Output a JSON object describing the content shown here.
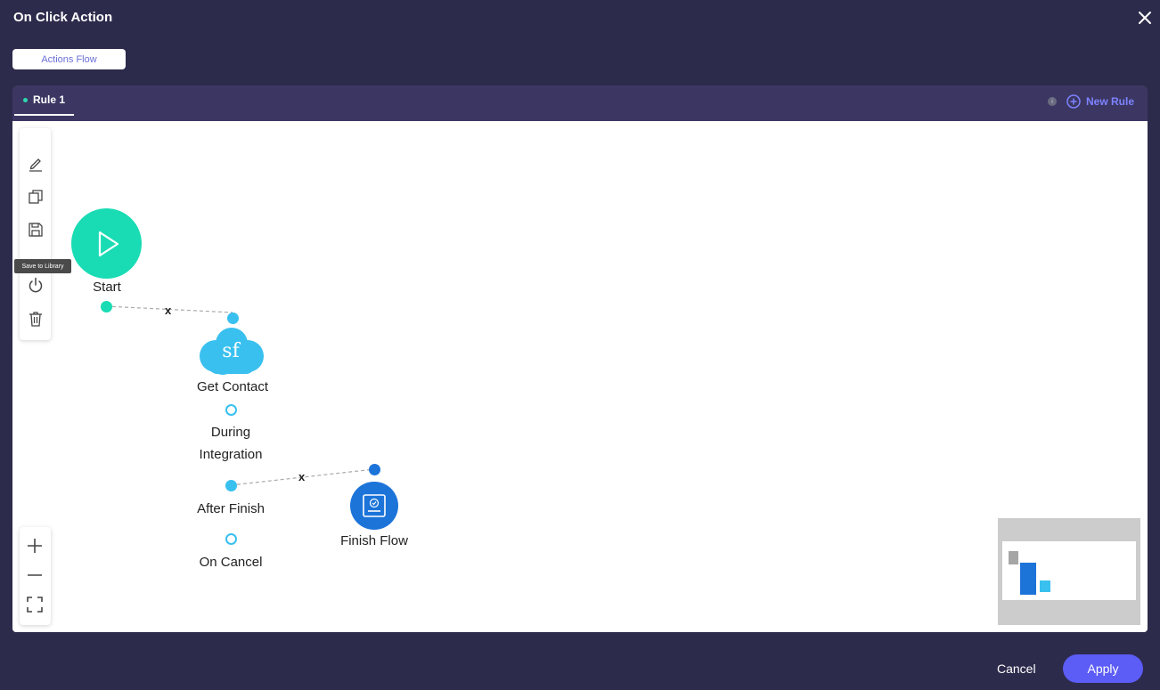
{
  "dialog": {
    "title": "On Click Action"
  },
  "tabs": {
    "actions_flow": "Actions Flow"
  },
  "rules": {
    "active_rule": "Rule 1",
    "info_glyph": "i",
    "new_rule_label": "New Rule"
  },
  "toolbar": {
    "tooltip": "Save to Library",
    "icons": [
      "pencil-icon",
      "copy-icon",
      "save-icon",
      "power-icon",
      "trash-icon"
    ]
  },
  "zoom": {
    "icons": [
      "plus-icon",
      "minus-icon",
      "fit-screen-icon"
    ]
  },
  "flow": {
    "start_label": "Start",
    "sf_glyph": "sf",
    "get_contact_label": "Get Contact",
    "during_label_1": "During",
    "during_label_2": "Integration",
    "after_finish_label": "After Finish",
    "on_cancel_label": "On Cancel",
    "finish_label": "Finish Flow",
    "connector_x": "x"
  },
  "footer": {
    "cancel_label": "Cancel",
    "apply_label": "Apply"
  },
  "colors": {
    "background": "#2d2b4c",
    "rules_bar": "#3c3762",
    "accent": "#5c5cf6",
    "start_node": "#19dcb4",
    "salesforce": "#39c0ef",
    "finish_node": "#1c74d9"
  }
}
